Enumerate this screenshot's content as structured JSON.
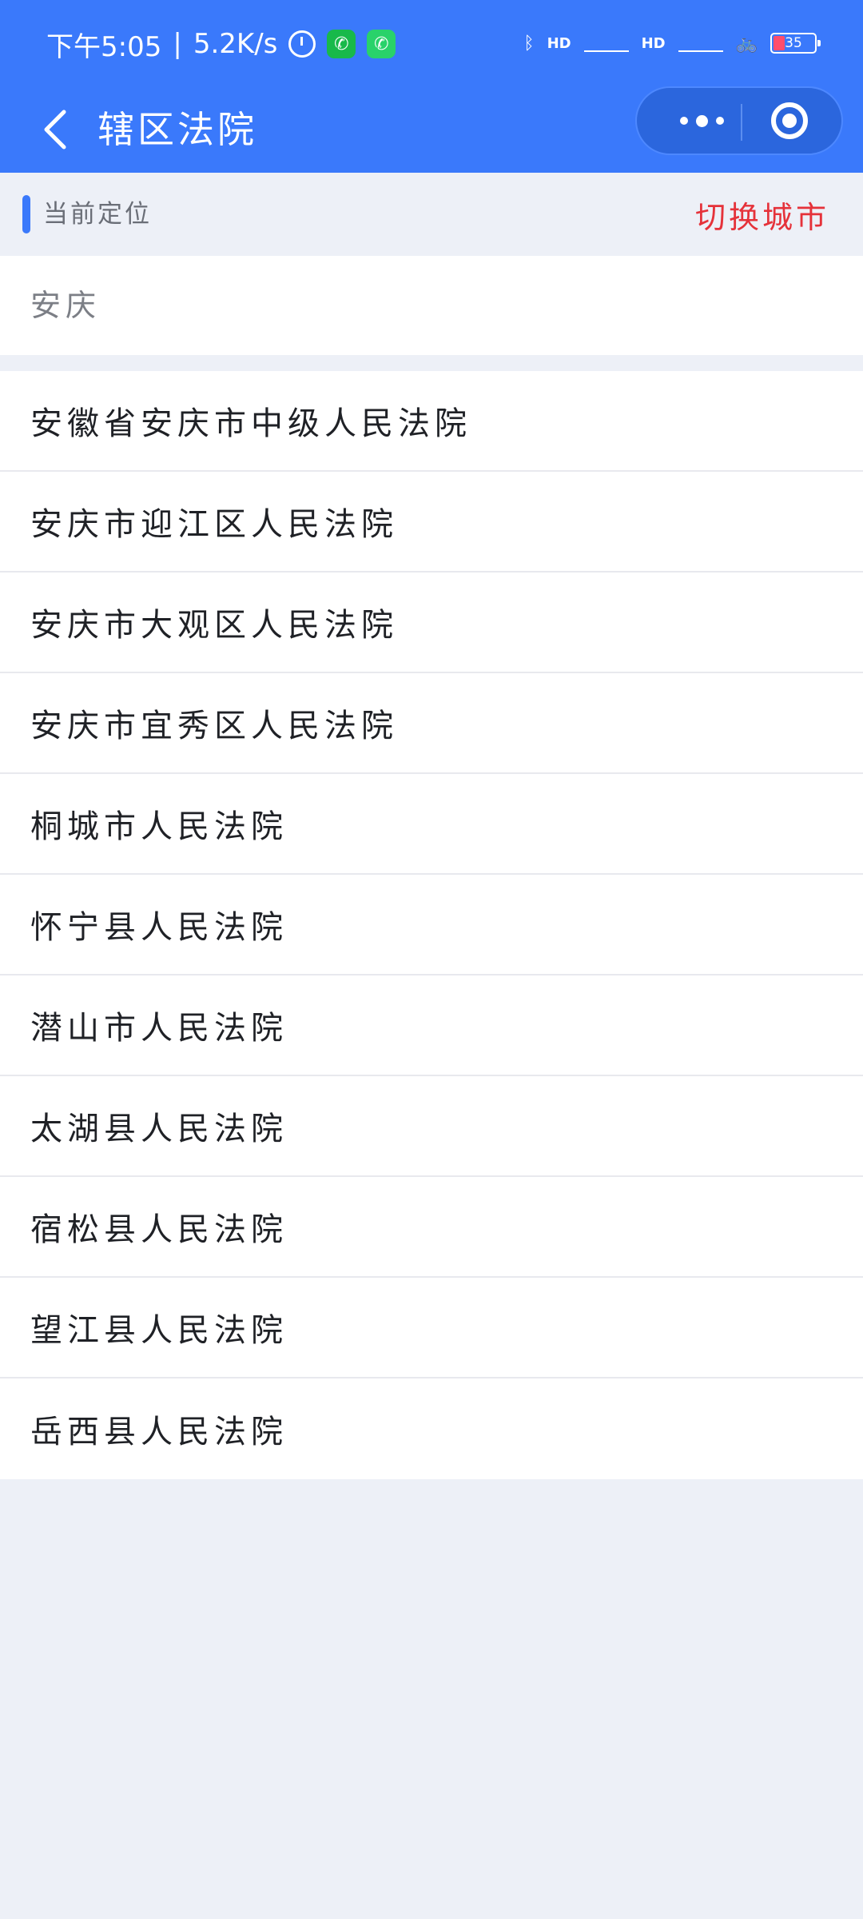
{
  "status_bar": {
    "time": "下午5:05",
    "separator": "|",
    "net_speed": "5.2K/s",
    "hd1": "HD",
    "hd2": "HD",
    "battery": "35"
  },
  "nav": {
    "title": "辖区法院",
    "back_icon": "chevron-left-icon",
    "more_icon": "more-dots-icon",
    "close_icon": "target-circle-icon"
  },
  "location": {
    "label": "当前定位",
    "switch_label": "切换城市",
    "current_city": "安庆"
  },
  "courts": [
    "安徽省安庆市中级人民法院",
    "安庆市迎江区人民法院",
    "安庆市大观区人民法院",
    "安庆市宜秀区人民法院",
    "桐城市人民法院",
    "怀宁县人民法院",
    "潜山市人民法院",
    "太湖县人民法院",
    "宿松县人民法院",
    "望江县人民法院",
    "岳西县人民法院"
  ],
  "colors": {
    "header": "#3a79fb",
    "accent_red": "#e5323a",
    "page_bg": "#edf0f7"
  }
}
